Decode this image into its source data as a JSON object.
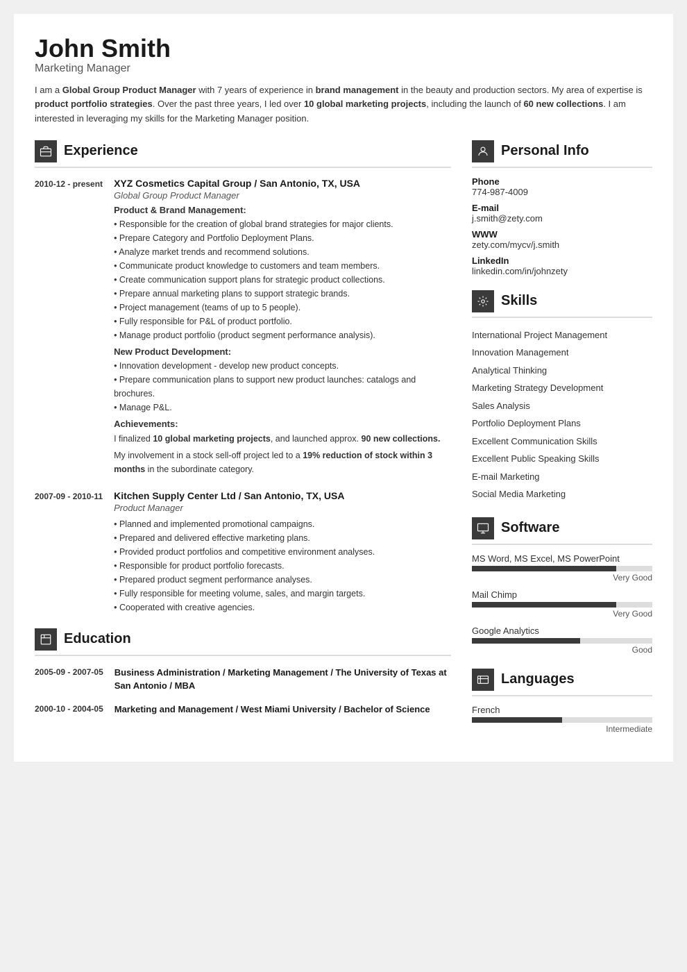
{
  "header": {
    "name": "John Smith",
    "title": "Marketing Manager",
    "summary_html": "I am a <strong>Global Group Product Manager</strong> with 7 years of experience in <strong>brand management</strong> in the beauty and production sectors. My area of expertise is <strong>product portfolio strategies</strong>. Over the past three years, I led over <strong>10 global marketing projects</strong>, including the launch of <strong>60 new collections</strong>. I am interested in leveraging my skills for the Marketing Manager position."
  },
  "experience": {
    "section_title": "Experience",
    "entries": [
      {
        "date": "2010-12 - present",
        "company": "XYZ Cosmetics Capital Group / San Antonio, TX, USA",
        "role": "Global Group Product Manager",
        "subsections": [
          {
            "subtitle": "Product & Brand Management:",
            "bullets": [
              "Responsible for the creation of global brand strategies for major clients.",
              "Prepare Category and Portfolio Deployment Plans.",
              "Analyze market trends and recommend solutions.",
              "Communicate product knowledge to customers and team members.",
              "Create communication support plans for strategic product collections.",
              "Prepare annual marketing plans to support strategic brands.",
              "Project management (teams of up to 5 people).",
              "Fully responsible for P&L of product portfolio.",
              "Manage product portfolio (product segment performance analysis)."
            ]
          },
          {
            "subtitle": "New Product Development:",
            "bullets": [
              "Innovation development - develop new product concepts.",
              "Prepare communication plans to support new product launches: catalogs and brochures.",
              "Manage P&L."
            ]
          },
          {
            "subtitle": "Achievements:",
            "bullets": []
          }
        ],
        "achievements": [
          "I finalized <strong>10 global marketing projects</strong>, and launched approx. <strong>90 new collections.</strong>",
          "My involvement in a stock sell-off project led to a <strong>19% reduction of stock within 3 months</strong> in the subordinate category."
        ]
      },
      {
        "date": "2007-09 - 2010-11",
        "company": "Kitchen Supply Center Ltd / San Antonio, TX, USA",
        "role": "Product Manager",
        "subsections": [],
        "bullets": [
          "Planned and implemented promotional campaigns.",
          "Prepared and delivered effective marketing plans.",
          "Provided product portfolios and competitive environment analyses.",
          "Responsible for product portfolio forecasts.",
          "Prepared product segment performance analyses.",
          "Fully responsible for meeting volume, sales, and margin targets.",
          "Cooperated with creative agencies."
        ]
      }
    ]
  },
  "education": {
    "section_title": "Education",
    "entries": [
      {
        "date": "2005-09 - 2007-05",
        "degree": "Business Administration / Marketing Management / The University of Texas at San Antonio / MBA"
      },
      {
        "date": "2000-10 - 2004-05",
        "degree": "Marketing and Management / West Miami University / Bachelor of Science"
      }
    ]
  },
  "personal_info": {
    "section_title": "Personal Info",
    "items": [
      {
        "label": "Phone",
        "value": "774-987-4009"
      },
      {
        "label": "E-mail",
        "value": "j.smith@zety.com"
      },
      {
        "label": "WWW",
        "value": "zety.com/mycv/j.smith"
      },
      {
        "label": "LinkedIn",
        "value": "linkedin.com/in/johnzety"
      }
    ]
  },
  "skills": {
    "section_title": "Skills",
    "items": [
      "International Project Management",
      "Innovation Management",
      "Analytical Thinking",
      "Marketing Strategy Development",
      "Sales Analysis",
      "Portfolio Deployment Plans",
      "Excellent Communication Skills",
      "Excellent Public Speaking Skills",
      "E-mail Marketing",
      "Social Media Marketing"
    ]
  },
  "software": {
    "section_title": "Software",
    "items": [
      {
        "name": "MS Word, MS Excel, MS PowerPoint",
        "level": "Very Good",
        "percent": 80
      },
      {
        "name": "Mail Chimp",
        "level": "Very Good",
        "percent": 80
      },
      {
        "name": "Google Analytics",
        "level": "Good",
        "percent": 60
      }
    ]
  },
  "languages": {
    "section_title": "Languages",
    "items": [
      {
        "name": "French",
        "level": "Intermediate",
        "percent": 50
      }
    ]
  },
  "icons": {
    "experience": "🗄",
    "education": "✉",
    "personal": "👤",
    "skills": "🔧",
    "software": "🖥",
    "languages": "🚩"
  }
}
